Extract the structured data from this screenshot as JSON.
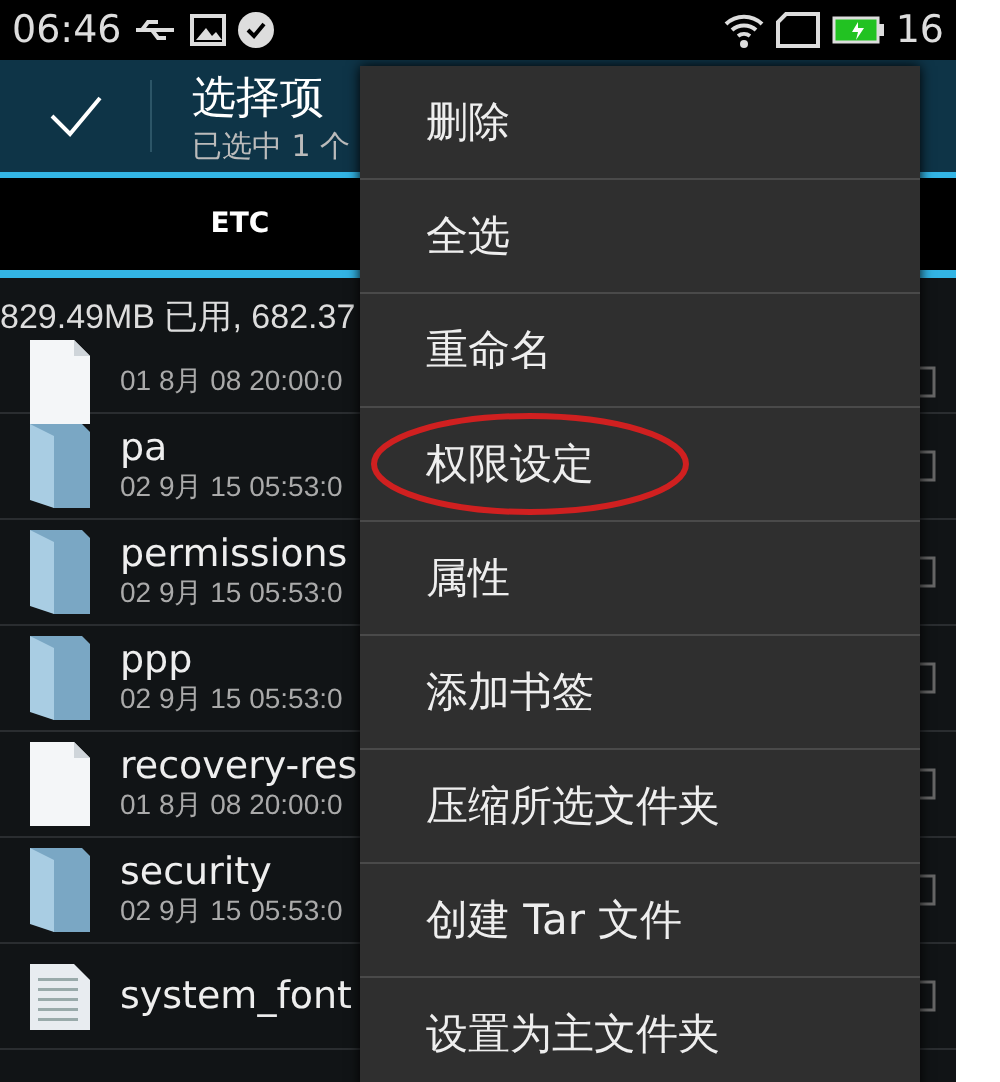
{
  "status_bar": {
    "time": "06:46",
    "battery": "16"
  },
  "action_bar": {
    "title": "选择项",
    "subtitle": "已选中 1 个"
  },
  "tabs": [
    {
      "label": "ETC",
      "selected": true
    }
  ],
  "storage": "829.49MB 已用, 682.37",
  "files": [
    {
      "kind": "file",
      "date": "01 8月 08 20:00:0"
    },
    {
      "kind": "folder",
      "name": "pa",
      "date": "02 9月 15 05:53:0"
    },
    {
      "kind": "folder",
      "name": "permissions",
      "date": "02 9月 15 05:53:0"
    },
    {
      "kind": "folder",
      "name": "ppp",
      "date": "02 9月 15 05:53:0"
    },
    {
      "kind": "file",
      "name": "recovery-res",
      "date": "01 8月 08 20:00:0"
    },
    {
      "kind": "folder",
      "name": "security",
      "date": "02 9月 15 05:53:0"
    },
    {
      "kind": "text",
      "name": "system_font"
    }
  ],
  "menu": [
    {
      "label": "删除",
      "highlighted": false
    },
    {
      "label": "全选",
      "highlighted": false
    },
    {
      "label": "重命名",
      "highlighted": false
    },
    {
      "label": "权限设定",
      "highlighted": true
    },
    {
      "label": "属性",
      "highlighted": false
    },
    {
      "label": "添加书签",
      "highlighted": false
    },
    {
      "label": "压缩所选文件夹",
      "highlighted": false
    },
    {
      "label": "创建 Tar 文件",
      "highlighted": false
    },
    {
      "label": "设置为主文件夹",
      "highlighted": false
    }
  ]
}
